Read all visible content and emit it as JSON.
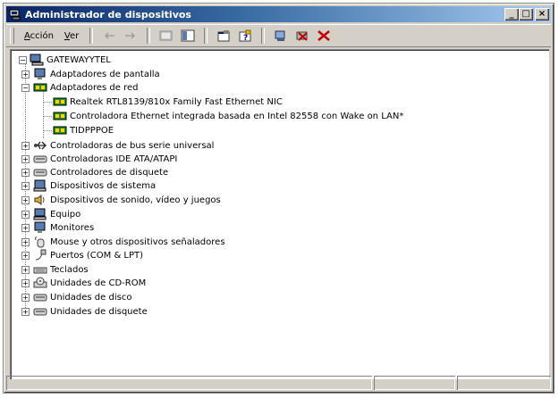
{
  "window": {
    "title": "Administrador de dispositivos"
  },
  "menu": {
    "accion_prefix": "A",
    "accion_rest": "cción",
    "ver_prefix": "V",
    "ver_rest": "er"
  },
  "tree": {
    "root": "GATEWAYYTEL",
    "items": [
      {
        "label": "Adaptadores de pantalla",
        "icon": "monitor-icon"
      },
      {
        "label": "Adaptadores de red",
        "icon": "network-card-icon",
        "expanded": true,
        "children": [
          "Realtek RTL8139/810x Family Fast Ethernet NIC",
          "Controladora Ethernet integrada basada en Intel 82558 con Wake on LAN*",
          "TIDPPPOE"
        ]
      },
      {
        "label": "Controladoras de bus serie universal",
        "icon": "usb-icon"
      },
      {
        "label": "Controladoras IDE ATA/ATAPI",
        "icon": "ide-icon"
      },
      {
        "label": "Controladores de disquete",
        "icon": "floppy-controller-icon"
      },
      {
        "label": "Dispositivos de sistema",
        "icon": "system-device-icon"
      },
      {
        "label": "Dispositivos de sonido, vídeo y juegos",
        "icon": "sound-icon"
      },
      {
        "label": "Equipo",
        "icon": "computer-icon"
      },
      {
        "label": "Monitores",
        "icon": "monitor-icon"
      },
      {
        "label": "Mouse y otros dispositivos señaladores",
        "icon": "mouse-icon"
      },
      {
        "label": "Puertos (COM & LPT)",
        "icon": "port-icon"
      },
      {
        "label": "Teclados",
        "icon": "keyboard-icon"
      },
      {
        "label": "Unidades de CD-ROM",
        "icon": "cdrom-icon"
      },
      {
        "label": "Unidades de disco",
        "icon": "disk-drive-icon"
      },
      {
        "label": "Unidades de disquete",
        "icon": "floppy-drive-icon"
      }
    ]
  },
  "colors": {
    "title_start": "#0a246a",
    "title_end": "#a6caf0",
    "chrome": "#d4d0c8"
  }
}
